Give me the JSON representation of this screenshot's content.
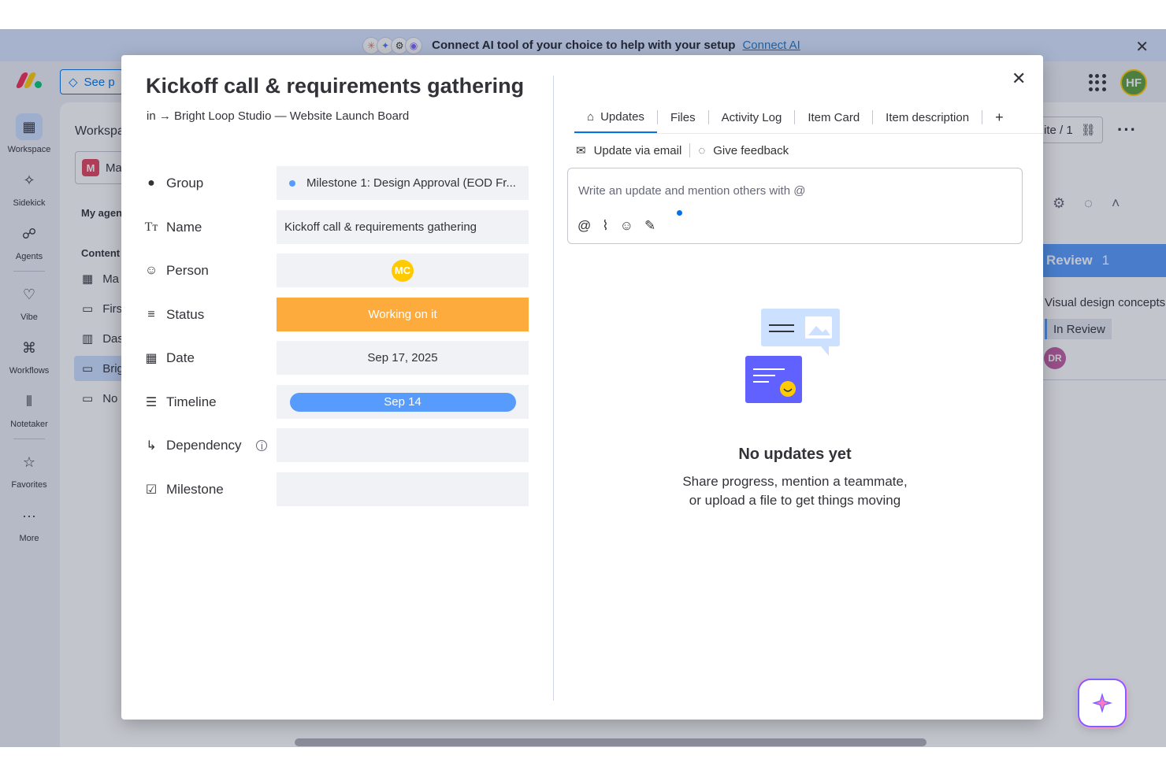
{
  "banner": {
    "text": "Connect AI tool of your choice to help with your setup",
    "link": "Connect AI",
    "close_icon": "close-icon"
  },
  "topbar": {
    "see_plans": "See p",
    "avatar": "HF"
  },
  "rail": {
    "items": [
      {
        "label": "Workspace",
        "icon": "grid-icon"
      },
      {
        "label": "Sidekick",
        "icon": "sparkle-icon"
      },
      {
        "label": "Agents",
        "icon": "agents-icon"
      },
      {
        "label": "Vibe",
        "icon": "heart-icon"
      },
      {
        "label": "Workflows",
        "icon": "workflows-icon"
      },
      {
        "label": "Notetaker",
        "icon": "waveform-icon"
      },
      {
        "label": "Favorites",
        "icon": "star-icon"
      },
      {
        "label": "More",
        "icon": "more-icon"
      }
    ]
  },
  "workspace_panel": {
    "title": "Workspa",
    "selector": "Ma",
    "badge": "M",
    "my_agents": "My agen",
    "content": "Content",
    "rows": [
      "Ma",
      "Firs",
      "Das",
      "Brig",
      "No"
    ]
  },
  "board": {
    "share_label": "ite / 1",
    "group_title": "Review",
    "group_count": "1",
    "task": "Visual design concepts",
    "status": "In Review",
    "person": "DR"
  },
  "modal": {
    "title": "Kickoff call & requirements gathering",
    "path_prefix": "in →",
    "path": "Bright Loop Studio — Website Launch Board",
    "fields": {
      "group": {
        "label": "Group",
        "value": "Milestone 1: Design Approval (EOD Fr..."
      },
      "name": {
        "label": "Name",
        "value": "Kickoff call & requirements gathering"
      },
      "person": {
        "label": "Person",
        "value": "MC"
      },
      "status": {
        "label": "Status",
        "value": "Working on it",
        "color": "#fdab3d"
      },
      "date": {
        "label": "Date",
        "value": "Sep 17, 2025"
      },
      "timeline": {
        "label": "Timeline",
        "value": "Sep 14"
      },
      "dependency": {
        "label": "Dependency",
        "value": ""
      },
      "milestone": {
        "label": "Milestone",
        "value": ""
      }
    },
    "tabs": [
      "Updates",
      "Files",
      "Activity Log",
      "Item Card",
      "Item description"
    ],
    "add_tab": "+",
    "update_via_email": "Update via email",
    "give_feedback": "Give feedback",
    "composer_placeholder": "Write an update and mention others with @",
    "empty_title": "No updates yet",
    "empty_line1": "Share progress, mention a teammate,",
    "empty_line2": "or upload a file to get things moving"
  },
  "colors": {
    "accent": "#0073ea",
    "status_working": "#fdab3d",
    "timeline": "#579bfc",
    "group_blue": "#579bfc"
  }
}
